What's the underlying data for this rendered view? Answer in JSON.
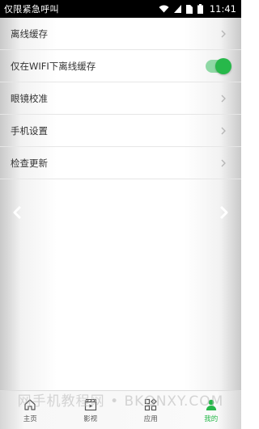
{
  "status_bar": {
    "carrier": "仅限紧急呼叫",
    "time": "11:41",
    "icons": [
      "wifi-icon",
      "signal-icon",
      "sim-icon",
      "battery-icon"
    ]
  },
  "settings": {
    "items": [
      {
        "label": "离线缓存",
        "control": "chevron"
      },
      {
        "label": "仅在WIFI下离线缓存",
        "control": "toggle",
        "toggle_on": true
      },
      {
        "label": "眼镜校准",
        "control": "chevron"
      },
      {
        "label": "手机设置",
        "control": "chevron"
      },
      {
        "label": "检查更新",
        "control": "chevron"
      }
    ]
  },
  "page_nav": {
    "prev_icon": "chevron-left-icon",
    "next_icon": "chevron-right-icon"
  },
  "watermark": "网手机教程网 • BKQNXY.COM",
  "tabs": [
    {
      "label": "主页",
      "icon": "home-icon",
      "active": false
    },
    {
      "label": "影视",
      "icon": "clapperboard-icon",
      "active": false
    },
    {
      "label": "应用",
      "icon": "apps-icon",
      "active": false
    },
    {
      "label": "我的",
      "icon": "person-icon",
      "active": true
    }
  ],
  "colors": {
    "accent": "#27b84a",
    "toggle_track": "#8fd8a5",
    "status_bar": "#000000",
    "text": "#333333"
  }
}
